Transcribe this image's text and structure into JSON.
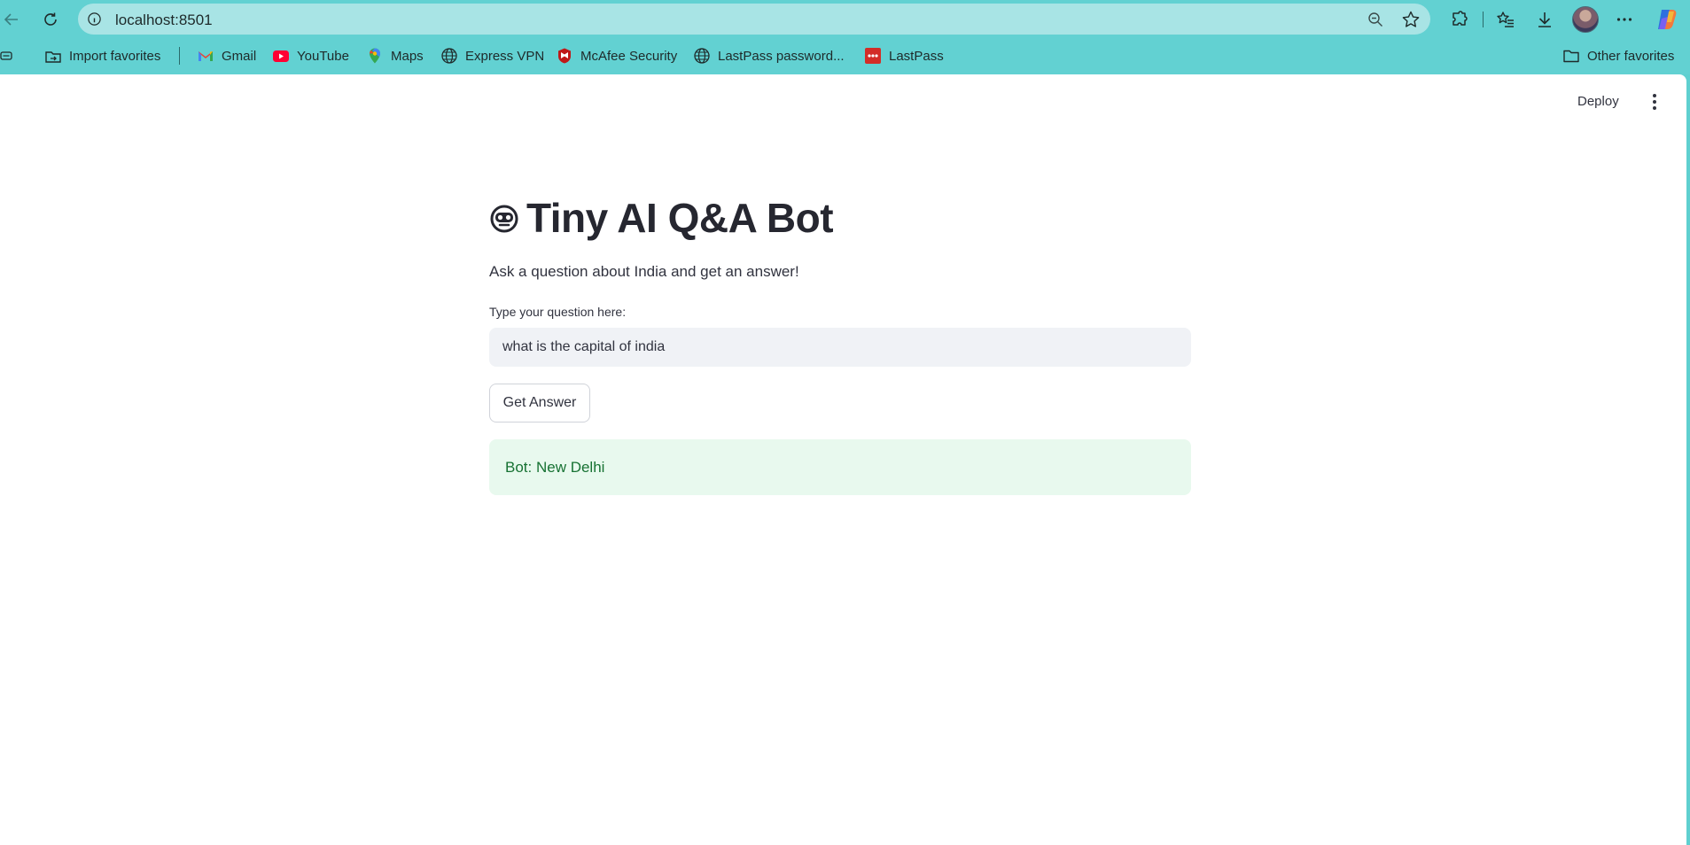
{
  "browser": {
    "url": "localhost:8501",
    "bookmarks": [
      {
        "label": "Import favorites",
        "icon": "import-favorites-icon"
      },
      {
        "label": "Gmail",
        "icon": "gmail-icon"
      },
      {
        "label": "YouTube",
        "icon": "youtube-icon"
      },
      {
        "label": "Maps",
        "icon": "maps-icon"
      },
      {
        "label": "Express VPN",
        "icon": "globe-icon"
      },
      {
        "label": "McAfee Security",
        "icon": "mcafee-icon"
      },
      {
        "label": "LastPass password...",
        "icon": "globe-icon"
      },
      {
        "label": "LastPass",
        "icon": "lastpass-icon"
      }
    ],
    "other_favorites": "Other favorites"
  },
  "app": {
    "deploy_label": "Deploy",
    "title": "Tiny AI Q&A Bot",
    "subtitle": "Ask a question about India and get an answer!",
    "input_label": "Type your question here:",
    "input_value": "what is the capital of india",
    "button_label": "Get Answer",
    "answer": "Bot: New Delhi"
  },
  "colors": {
    "chrome": "#62d1d2",
    "address_bar": "#a8e4e5",
    "input_bg": "#f0f2f6",
    "success_bg": "#e8f9ee",
    "success_text": "#177233"
  }
}
